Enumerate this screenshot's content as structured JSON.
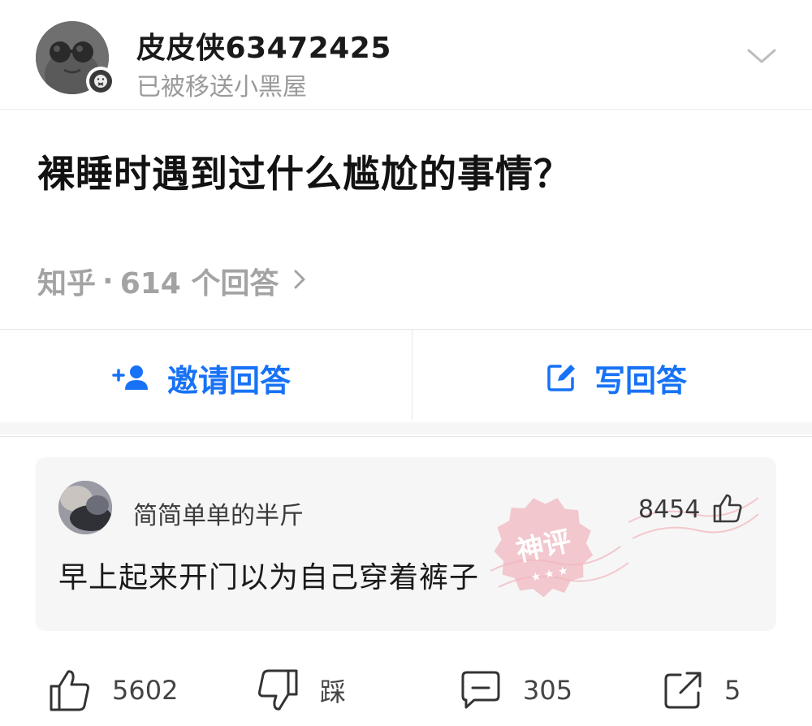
{
  "header": {
    "username": "皮皮侠63472425",
    "status": "已被移送小黑屋",
    "avatar_icon": "sunglasses-avatar-icon",
    "badge_icon": "banned-badge-icon",
    "expand_icon": "chevron-down-icon"
  },
  "question": {
    "title": "裸睡时遇到过什么尴尬的事情？",
    "source": "知乎",
    "separator": "·",
    "answer_count_label": "614 个回答",
    "more_icon": "chevron-right-icon"
  },
  "actions": {
    "invite_label": "邀请回答",
    "invite_icon": "add-user-icon",
    "write_label": "写回答",
    "write_icon": "edit-icon"
  },
  "hot_comment": {
    "author": "简简单单的半斤",
    "likes": "8454",
    "like_icon": "thumbs-up-icon",
    "text": "早上起来开门以为自己穿着裤子",
    "stamp_text": "神评",
    "stamp_color": "#e8919b"
  },
  "bottom_bar": {
    "like_count": "5602",
    "dislike_label": "踩",
    "comment_count": "305",
    "share_count": "5"
  },
  "colors": {
    "accent": "#1772f6",
    "muted": "#9a9a9a",
    "panel": "#f6f6f6"
  }
}
